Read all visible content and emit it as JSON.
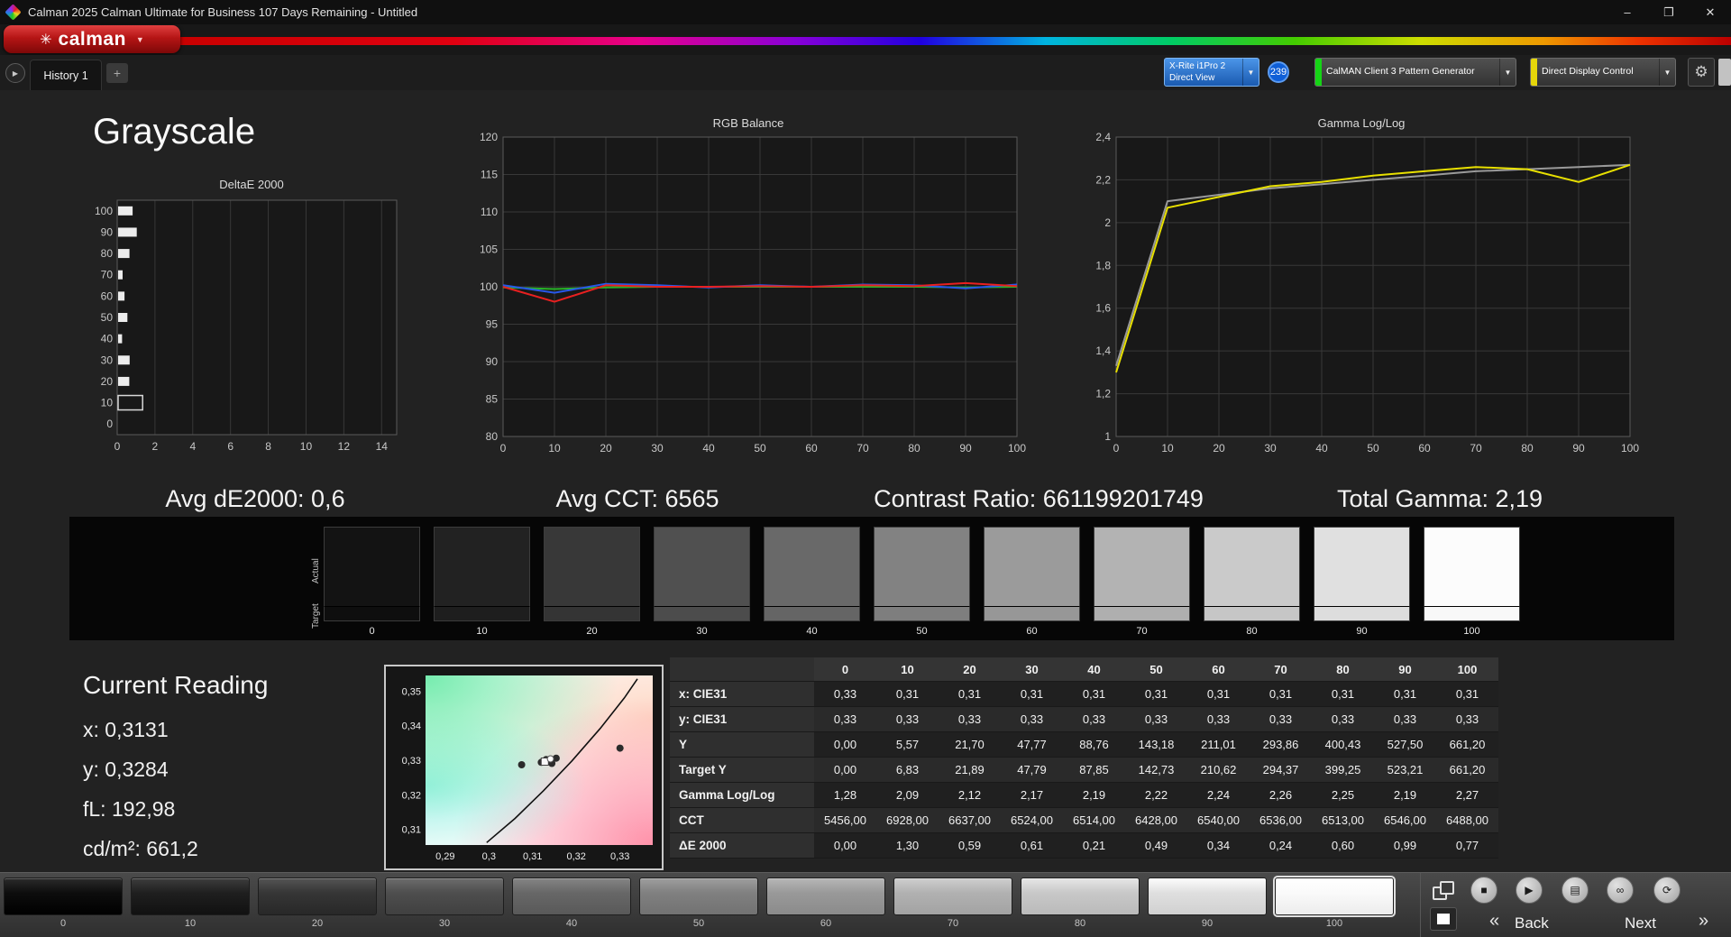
{
  "window": {
    "title": "Calman 2025 Calman Ultimate for Business 107 Days Remaining  - Untitled",
    "minimize": "–",
    "maximize": "❐",
    "close": "✕"
  },
  "brand": {
    "logo_text": "calman",
    "logo_color": "#b51515"
  },
  "icons": {
    "logo_mark": "✳",
    "dropdown_chevron": "▼",
    "tab_scroll": "▶",
    "gear": "⚙",
    "stop": "■",
    "play": "▶",
    "save": "▤",
    "link": "∞",
    "refresh": "⟳",
    "back_chevron": "«",
    "next_chevron": "»"
  },
  "tab_bar": {
    "history_tab": "History 1",
    "add_tab": "+",
    "meter": {
      "line1": "X-Rite i1Pro 2",
      "line2": "Direct View",
      "badge": "239",
      "color": "#2a6fc8"
    },
    "pattern_generator": {
      "label": "CalMAN Client 3 Pattern Generator",
      "accent": "#15d415"
    },
    "display_control": {
      "label": "Direct Display Control",
      "accent": "#e6d60a"
    }
  },
  "page": {
    "title": "Grayscale"
  },
  "stats": {
    "avg_de2000": "Avg dE2000: 0,6",
    "avg_cct": "Avg CCT: 6565",
    "contrast_ratio": "Contrast Ratio: 661199201749",
    "total_gamma": "Total Gamma: 2,19"
  },
  "grayscale_strip": {
    "actual_label": "Actual",
    "target_label": "Target",
    "levels": [
      "0",
      "10",
      "20",
      "30",
      "40",
      "50",
      "60",
      "70",
      "80",
      "90",
      "100"
    ],
    "actual_colors": [
      "#131313",
      "#222222",
      "#383838",
      "#505050",
      "#696969",
      "#828282",
      "#9b9b9b",
      "#b3b3b3",
      "#cacaca",
      "#e0e0e0",
      "#fcfcfc"
    ],
    "target_colors": [
      "#0e0e0e",
      "#1e1e1e",
      "#343434",
      "#4c4c4c",
      "#656565",
      "#7e7e7e",
      "#979797",
      "#afafaf",
      "#c6c6c6",
      "#dddddd",
      "#f8f8f8"
    ]
  },
  "current_reading": {
    "heading": "Current Reading",
    "lines": [
      "x: 0,3131",
      "y: 0,3284",
      "fL: 192,98",
      "cd/m²: 661,2"
    ]
  },
  "table": {
    "columns": [
      "0",
      "10",
      "20",
      "30",
      "40",
      "50",
      "60",
      "70",
      "80",
      "90",
      "100"
    ],
    "rows": [
      {
        "label": "x: CIE31",
        "values": [
          "0,33",
          "0,31",
          "0,31",
          "0,31",
          "0,31",
          "0,31",
          "0,31",
          "0,31",
          "0,31",
          "0,31",
          "0,31"
        ]
      },
      {
        "label": "y: CIE31",
        "values": [
          "0,33",
          "0,33",
          "0,33",
          "0,33",
          "0,33",
          "0,33",
          "0,33",
          "0,33",
          "0,33",
          "0,33",
          "0,33"
        ]
      },
      {
        "label": "Y",
        "values": [
          "0,00",
          "5,57",
          "21,70",
          "47,77",
          "88,76",
          "143,18",
          "211,01",
          "293,86",
          "400,43",
          "527,50",
          "661,20"
        ]
      },
      {
        "label": "Target Y",
        "values": [
          "0,00",
          "6,83",
          "21,89",
          "47,79",
          "87,85",
          "142,73",
          "210,62",
          "294,37",
          "399,25",
          "523,21",
          "661,20"
        ]
      },
      {
        "label": "Gamma Log/Log",
        "values": [
          "1,28",
          "2,09",
          "2,12",
          "2,17",
          "2,19",
          "2,22",
          "2,24",
          "2,26",
          "2,25",
          "2,19",
          "2,27"
        ]
      },
      {
        "label": "CCT",
        "values": [
          "5456,00",
          "6928,00",
          "6637,00",
          "6524,00",
          "6514,00",
          "6428,00",
          "6540,00",
          "6536,00",
          "6513,00",
          "6546,00",
          "6488,00"
        ]
      },
      {
        "label": "ΔE 2000",
        "values": [
          "0,00",
          "1,30",
          "0,59",
          "0,61",
          "0,21",
          "0,49",
          "0,34",
          "0,24",
          "0,60",
          "0,99",
          "0,77"
        ]
      }
    ]
  },
  "pattern_toolbar": {
    "levels": [
      "0",
      "10",
      "20",
      "30",
      "40",
      "50",
      "60",
      "70",
      "80",
      "90",
      "100"
    ],
    "colors": [
      "#0d0d0d",
      "#1f1f1f",
      "#363636",
      "#4e4e4e",
      "#676767",
      "#808080",
      "#999999",
      "#b1b1b1",
      "#c8c8c8",
      "#dfdfdf",
      "#fafafa"
    ],
    "selected": "100",
    "back_label": "Back",
    "next_label": "Next"
  },
  "chart_data": [
    {
      "id": "deltae",
      "type": "bar",
      "orientation": "horizontal",
      "title": "DeltaE 2000",
      "categories": [
        "0",
        "10",
        "20",
        "30",
        "40",
        "50",
        "60",
        "70",
        "80",
        "90",
        "100"
      ],
      "values": [
        0.0,
        1.3,
        0.59,
        0.61,
        0.21,
        0.49,
        0.34,
        0.24,
        0.6,
        0.99,
        0.77
      ],
      "highlight_level": "10",
      "xlim": [
        0,
        14.8
      ],
      "xticks": [
        0,
        2,
        4,
        6,
        8,
        10,
        12,
        14
      ],
      "bar_color": "#ececec"
    },
    {
      "id": "rgb_balance",
      "type": "line",
      "title": "RGB Balance",
      "x": [
        0,
        10,
        20,
        30,
        40,
        50,
        60,
        70,
        80,
        90,
        100
      ],
      "series": [
        {
          "name": "Green",
          "color": "#28b428",
          "values": [
            99.9,
            99.7,
            99.9,
            100.0,
            100.0,
            100.0,
            100.0,
            100.0,
            100.0,
            99.9,
            100.0
          ]
        },
        {
          "name": "Blue",
          "color": "#2858e8",
          "values": [
            100.2,
            99.2,
            100.4,
            100.2,
            99.9,
            100.2,
            100.0,
            100.3,
            100.2,
            99.8,
            100.3
          ]
        },
        {
          "name": "Red",
          "color": "#e82020",
          "values": [
            100.0,
            98.0,
            100.2,
            100.0,
            100.0,
            100.1,
            100.0,
            100.2,
            100.1,
            100.5,
            100.1
          ]
        }
      ],
      "ylim": [
        80,
        120
      ],
      "yticks": [
        80,
        85,
        90,
        95,
        100,
        105,
        110,
        115,
        120
      ],
      "xticks": [
        0,
        10,
        20,
        30,
        40,
        50,
        60,
        70,
        80,
        90,
        100
      ]
    },
    {
      "id": "gamma",
      "type": "line",
      "title": "Gamma Log/Log",
      "x": [
        0,
        10,
        20,
        30,
        40,
        50,
        60,
        70,
        80,
        90,
        100
      ],
      "series": [
        {
          "name": "Reference",
          "color": "#9a9a9a",
          "values": [
            1.33,
            2.1,
            2.13,
            2.16,
            2.18,
            2.2,
            2.22,
            2.24,
            2.25,
            2.26,
            2.27
          ]
        },
        {
          "name": "Measured",
          "color": "#e8e000",
          "values": [
            1.3,
            2.07,
            2.12,
            2.17,
            2.19,
            2.22,
            2.24,
            2.26,
            2.25,
            2.19,
            2.27
          ]
        }
      ],
      "ylim": [
        1,
        2.4
      ],
      "yticks": [
        1,
        1.2,
        1.4,
        1.6,
        1.8,
        2,
        2.2,
        2.4
      ],
      "ytick_labels": [
        "1",
        "1,2",
        "1,4",
        "1,6",
        "1,8",
        "2",
        "2,2",
        "2,4"
      ],
      "xticks": [
        0,
        10,
        20,
        30,
        40,
        50,
        60,
        70,
        80,
        90,
        100
      ]
    },
    {
      "id": "cie",
      "type": "scatter",
      "title": "CIE 1931 xy",
      "x_range": [
        0.2855,
        0.3375
      ],
      "y_range": [
        0.3055,
        0.3545
      ],
      "xticks": [
        {
          "v": 0.29,
          "label": "0,29"
        },
        {
          "v": 0.3,
          "label": "0,3"
        },
        {
          "v": 0.31,
          "label": "0,31"
        },
        {
          "v": 0.32,
          "label": "0,32"
        },
        {
          "v": 0.33,
          "label": "0,33"
        }
      ],
      "yticks": [
        {
          "v": 0.35,
          "label": "0,35"
        },
        {
          "v": 0.34,
          "label": "0,34"
        },
        {
          "v": 0.33,
          "label": "0,33"
        },
        {
          "v": 0.32,
          "label": "0,32"
        },
        {
          "v": 0.31,
          "label": "0,31"
        }
      ],
      "points": [
        [
          0.3075,
          0.3287
        ],
        [
          0.312,
          0.3294
        ],
        [
          0.3131,
          0.3302
        ],
        [
          0.3144,
          0.3291
        ],
        [
          0.3154,
          0.3306
        ],
        [
          0.33,
          0.3335
        ]
      ],
      "target_marker": [
        0.3128,
        0.3296
      ],
      "current_marker": [
        0.3141,
        0.3304
      ],
      "locus": [
        [
          0.2995,
          0.3062
        ],
        [
          0.306,
          0.3132
        ],
        [
          0.3125,
          0.3212
        ],
        [
          0.319,
          0.3298
        ],
        [
          0.3255,
          0.3392
        ],
        [
          0.331,
          0.348
        ],
        [
          0.334,
          0.3535
        ]
      ]
    }
  ]
}
